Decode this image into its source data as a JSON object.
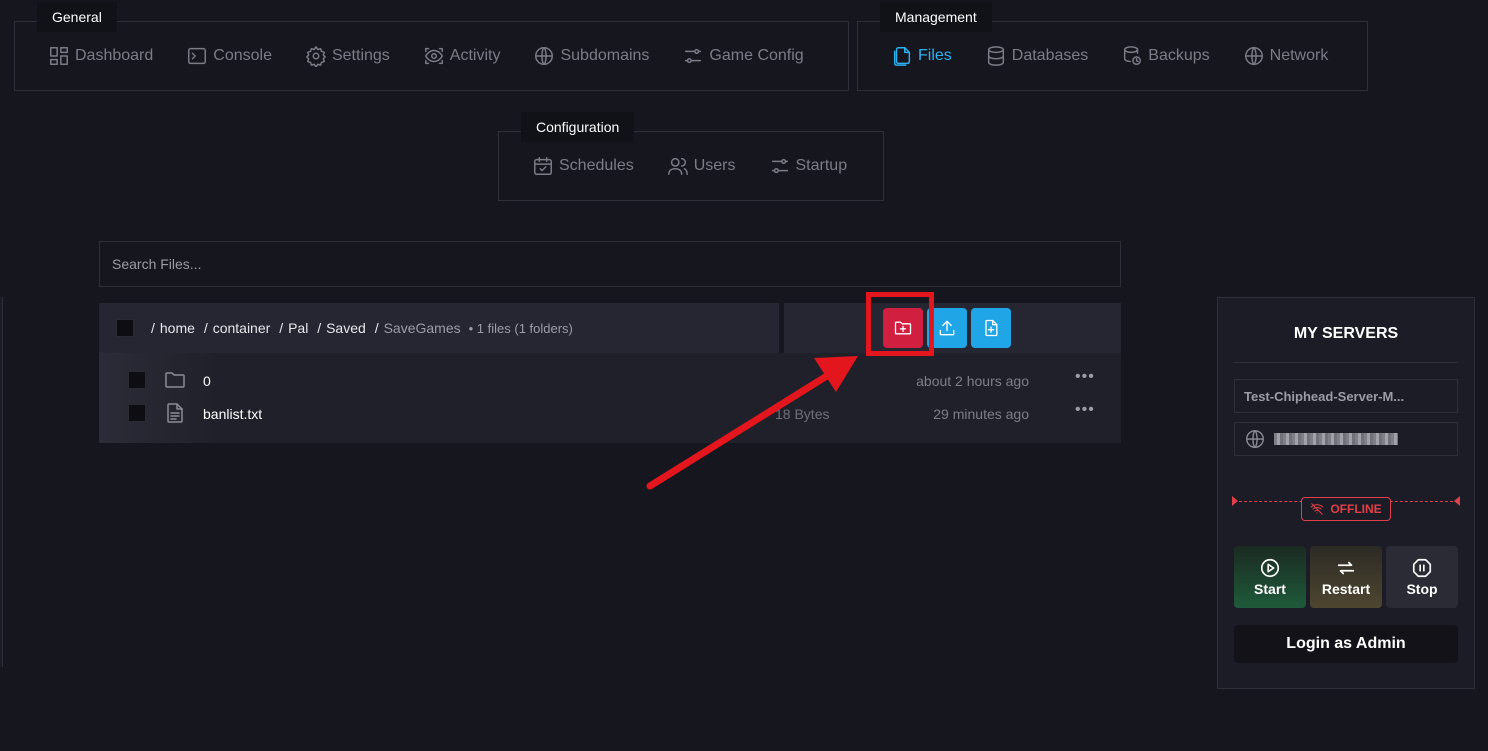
{
  "nav": {
    "general": {
      "label": "General",
      "items": [
        {
          "label": "Dashboard",
          "icon": "dashboard-icon"
        },
        {
          "label": "Console",
          "icon": "terminal-icon"
        },
        {
          "label": "Settings",
          "icon": "gear-icon"
        },
        {
          "label": "Activity",
          "icon": "eye-icon"
        },
        {
          "label": "Subdomains",
          "icon": "globe-icon"
        },
        {
          "label": "Game Config",
          "icon": "sliders-icon"
        }
      ]
    },
    "management": {
      "label": "Management",
      "items": [
        {
          "label": "Files",
          "icon": "files-icon",
          "active": true
        },
        {
          "label": "Databases",
          "icon": "database-icon"
        },
        {
          "label": "Backups",
          "icon": "backup-icon"
        },
        {
          "label": "Network",
          "icon": "globe-icon"
        }
      ]
    },
    "configuration": {
      "label": "Configuration",
      "items": [
        {
          "label": "Schedules",
          "icon": "calendar-icon"
        },
        {
          "label": "Users",
          "icon": "users-icon"
        },
        {
          "label": "Startup",
          "icon": "sliders-icon"
        }
      ]
    }
  },
  "search": {
    "placeholder": "Search Files..."
  },
  "path": {
    "segments": [
      "home",
      "container",
      "Pal",
      "Saved"
    ],
    "current": "SaveGames",
    "summary": "• 1 files (1 folders)"
  },
  "actions": {
    "new_folder_color": "#d11f40",
    "upload_color": "#20a6e6",
    "new_file_color": "#20a6e6"
  },
  "files": [
    {
      "name": "0",
      "type": "folder",
      "size": "",
      "modified": "about 2 hours ago"
    },
    {
      "name": "banlist.txt",
      "type": "file",
      "size": "18 Bytes",
      "modified": "29 minutes ago"
    }
  ],
  "panel": {
    "title": "MY SERVERS",
    "server_name": "Test-Chiphead-Server-M...",
    "status": "OFFLINE",
    "status_color": "#e0404a",
    "buttons": {
      "start": "Start",
      "restart": "Restart",
      "stop": "Stop"
    },
    "login": "Login as Admin"
  }
}
